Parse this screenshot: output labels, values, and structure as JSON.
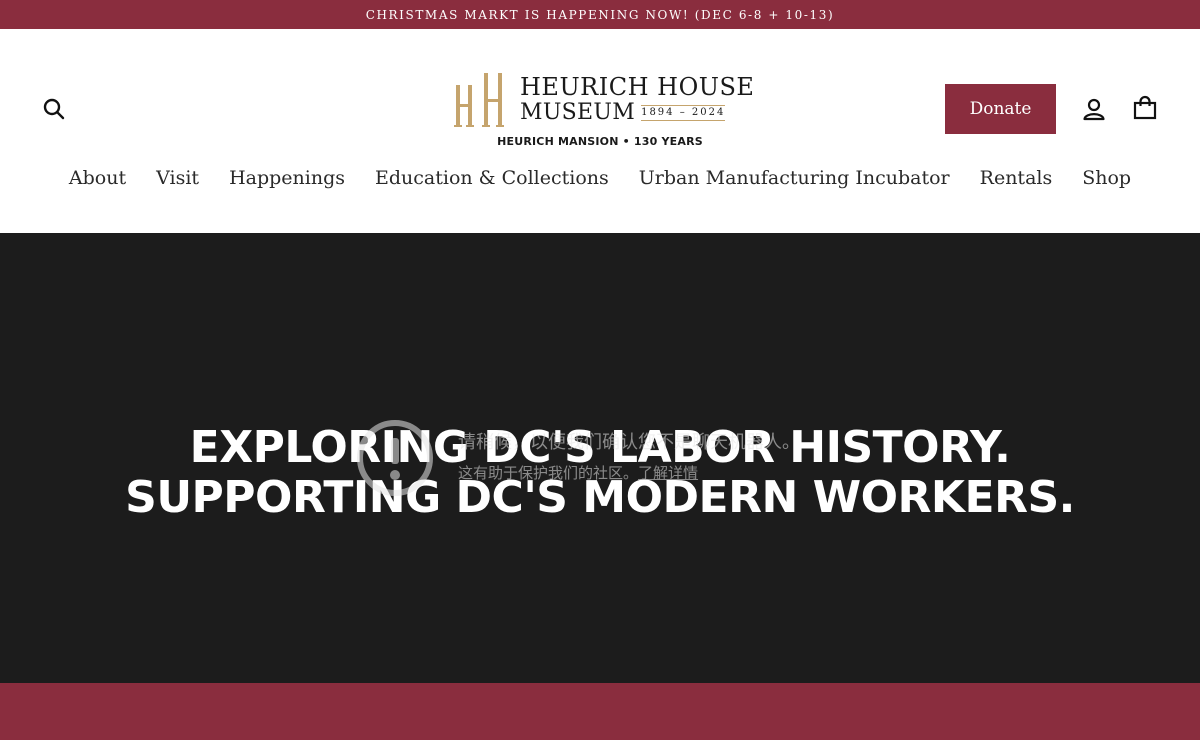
{
  "announcement": "CHRISTMAS MARKT IS HAPPENING NOW! (DEC 6-8 + 10-13)",
  "header": {
    "donate_label": "Donate",
    "icons": {
      "search": "search-icon",
      "account": "user-icon",
      "cart": "shopping-bag-icon"
    }
  },
  "logo": {
    "line1": "HEURICH HOUSE",
    "line2": "MUSEUM",
    "years": "1894 – 2024",
    "tagline": "HEURICH MANSION • 130 YEARS",
    "monogram": "HH"
  },
  "nav": {
    "items": [
      {
        "label": "About"
      },
      {
        "label": "Visit"
      },
      {
        "label": "Happenings"
      },
      {
        "label": "Education & Collections"
      },
      {
        "label": "Urban Manufacturing Incubator"
      },
      {
        "label": "Rentals"
      },
      {
        "label": "Shop"
      }
    ]
  },
  "hero": {
    "line1": "EXPLORING DC'S LABOR HISTORY.",
    "line2": "SUPPORTING DC'S MODERN WORKERS."
  },
  "overlay": {
    "title": "请稍候，以便我们确认您不是聊天机器人。",
    "subtitle": "这有助于保护我们的社区。",
    "link": "了解详情"
  },
  "colors": {
    "brand": "#8a2d3e",
    "gold": "#c5a46d",
    "hero_bg": "#1c1c1c",
    "text_dark": "#2a2a2a"
  }
}
